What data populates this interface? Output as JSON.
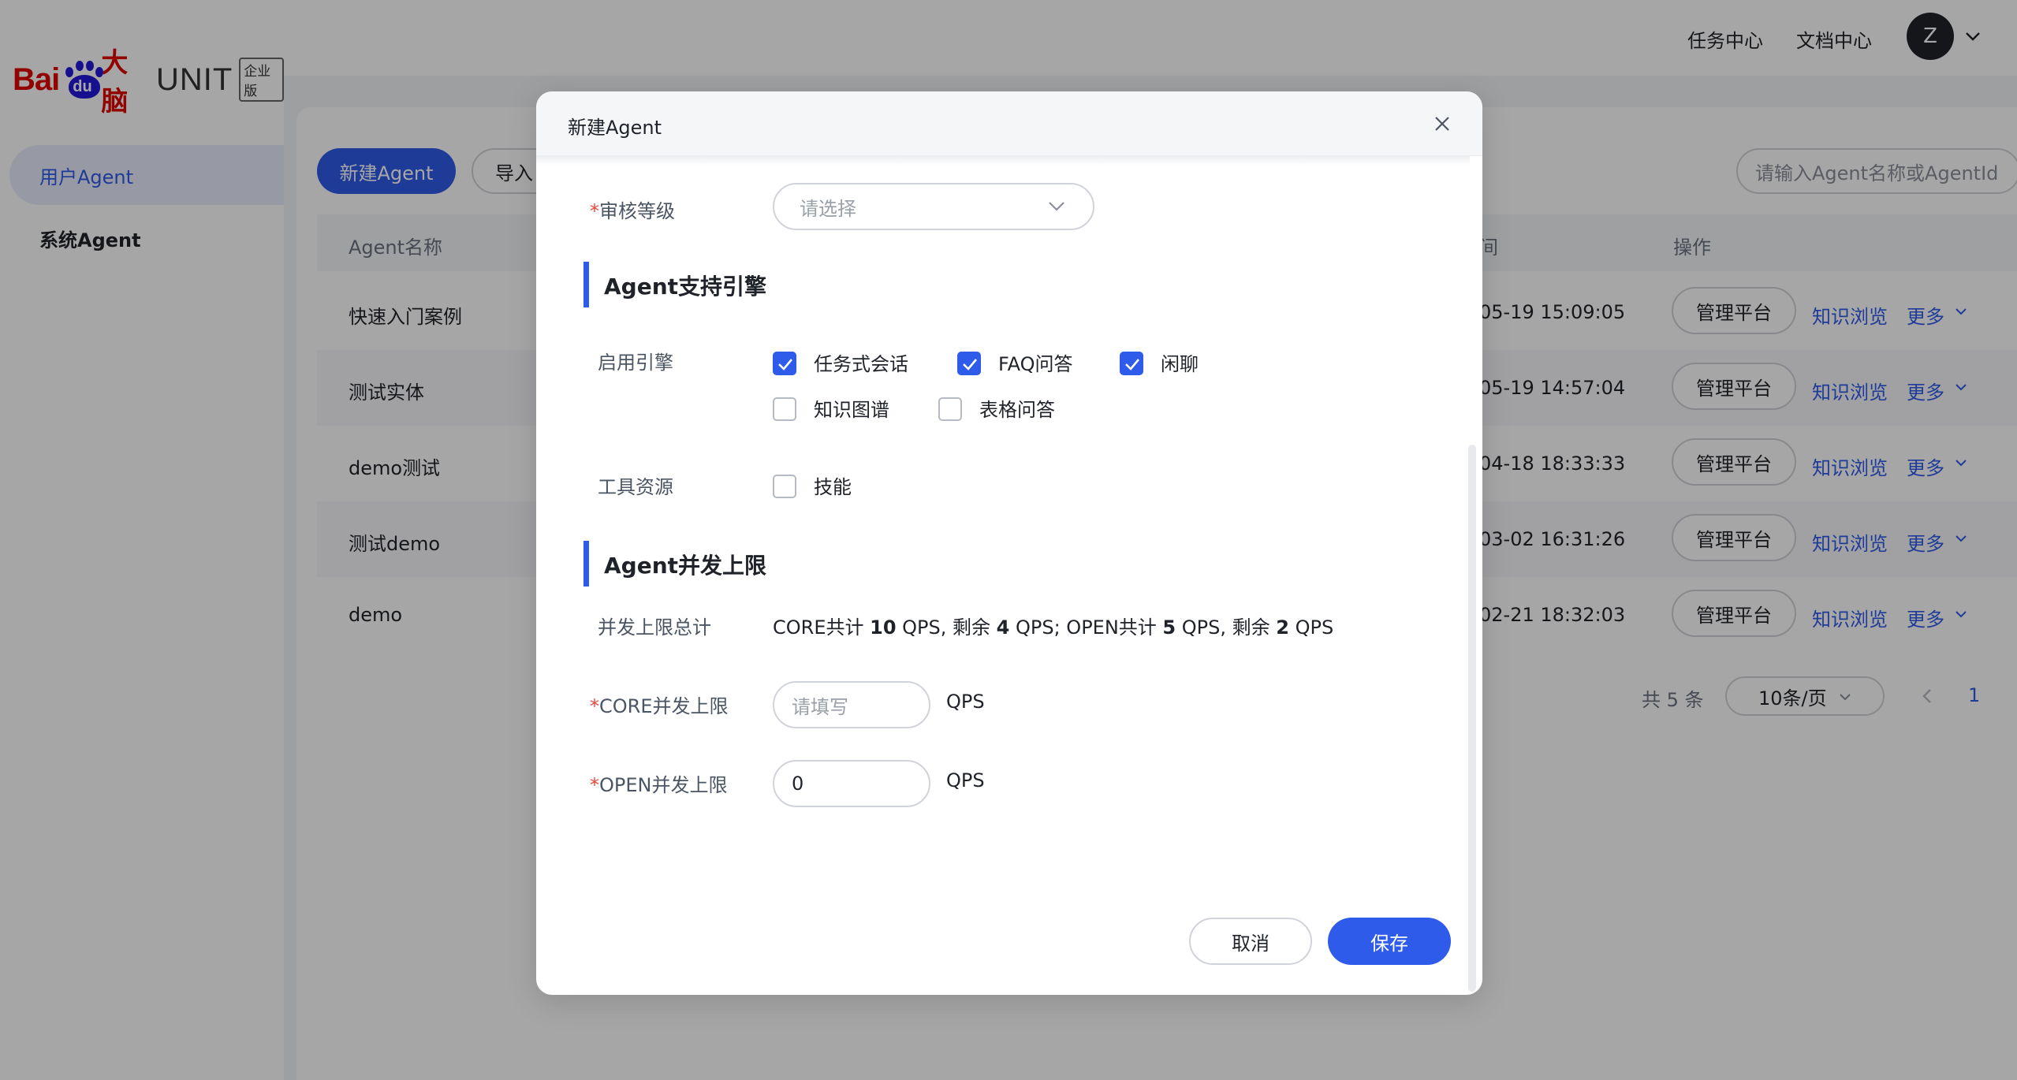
{
  "brand": {
    "logo_text_bai": "Bai",
    "logo_text_du": "du",
    "logo_text_danao": "大脑",
    "logo_text_unit": "UNIT",
    "logo_badge": "企业版"
  },
  "sidebar": {
    "items": [
      {
        "label": "用户Agent",
        "active": true
      },
      {
        "label": "系统Agent",
        "active": false
      }
    ]
  },
  "topbar": {
    "links": [
      "任务中心",
      "文档中心"
    ],
    "avatar_initial": "Z"
  },
  "toolbar": {
    "new_label": "新建Agent",
    "import_label": "导入",
    "search_placeholder": "请输入Agent名称或AgentId"
  },
  "table": {
    "columns": [
      "Agent名称",
      "间",
      "操作"
    ],
    "rows": [
      {
        "name": "快速入门案例",
        "time": "05-19 15:09:05",
        "manage": "管理平台",
        "kb": "知识浏览",
        "more": "更多"
      },
      {
        "name": "测试实体",
        "time": "05-19 14:57:04",
        "manage": "管理平台",
        "kb": "知识浏览",
        "more": "更多"
      },
      {
        "name": "demo测试",
        "time": "04-18 18:33:33",
        "manage": "管理平台",
        "kb": "知识浏览",
        "more": "更多"
      },
      {
        "name": "测试demo",
        "time": "03-02 16:31:26",
        "manage": "管理平台",
        "kb": "知识浏览",
        "more": "更多"
      },
      {
        "name": "demo",
        "time": "02-21 18:32:03",
        "manage": "管理平台",
        "kb": "知识浏览",
        "more": "更多"
      }
    ]
  },
  "pager": {
    "total": "共 5 条",
    "page_size": "10条/页",
    "current_page": "1"
  },
  "modal": {
    "title": "新建Agent",
    "review_level": {
      "required": "*",
      "label": "审核等级",
      "placeholder": "请选择"
    },
    "engine_section_title": "Agent支持引擎",
    "engines_label": "启用引擎",
    "engines": [
      {
        "label": "任务式会话",
        "checked": true
      },
      {
        "label": "FAQ问答",
        "checked": true
      },
      {
        "label": "闲聊",
        "checked": true
      },
      {
        "label": "知识图谱",
        "checked": false
      },
      {
        "label": "表格问答",
        "checked": false
      }
    ],
    "tools_label": "工具资源",
    "tools": [
      {
        "label": "技能",
        "checked": false
      }
    ],
    "concurrency_section_title": "Agent并发上限",
    "total_label": "并发上限总计",
    "summary": {
      "core_prefix": "CORE共计 ",
      "core_total": "10",
      "core_rest_prefix": " QPS, 剩余 ",
      "core_rest": "4",
      "open_prefix": " QPS; OPEN共计 ",
      "open_total": "5",
      "open_rest_prefix": " QPS, 剩余 ",
      "open_rest": "2",
      "suffix": " QPS"
    },
    "core_limit": {
      "required": "*",
      "label": "CORE并发上限",
      "placeholder": "请填写",
      "value": "",
      "unit": "QPS"
    },
    "open_limit": {
      "required": "*",
      "label": "OPEN并发上限",
      "value": "0",
      "unit": "QPS"
    },
    "cancel_label": "取消",
    "save_label": "保存"
  },
  "colors": {
    "accent": "#2f5bea",
    "required": "#f0443b",
    "brand_red": "#e10601",
    "brand_blue": "#2319dc"
  }
}
